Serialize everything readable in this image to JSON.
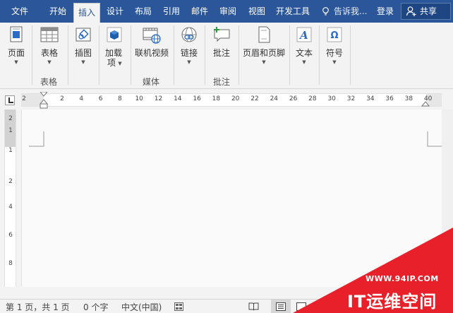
{
  "tabs": [
    {
      "label": "文件",
      "active": false
    },
    {
      "label": "开始",
      "active": false
    },
    {
      "label": "插入",
      "active": true
    },
    {
      "label": "设计",
      "active": false
    },
    {
      "label": "布局",
      "active": false
    },
    {
      "label": "引用",
      "active": false
    },
    {
      "label": "邮件",
      "active": false
    },
    {
      "label": "审阅",
      "active": false
    },
    {
      "label": "视图",
      "active": false
    },
    {
      "label": "开发工具",
      "active": false
    }
  ],
  "tell_me": "告诉我...",
  "login": "登录",
  "share": "共享",
  "ribbon": {
    "buttons": [
      {
        "label": "页面",
        "icon": "page-icon"
      },
      {
        "label": "表格",
        "icon": "table-icon"
      },
      {
        "label": "插图",
        "icon": "illustration-icon"
      },
      {
        "label": "加载项",
        "label_line1": "加载",
        "label_line2": "项",
        "icon": "addin-icon"
      },
      {
        "label": "联机视频",
        "icon": "online-video-icon"
      },
      {
        "label": "链接",
        "icon": "link-icon"
      },
      {
        "label": "批注",
        "icon": "comment-icon"
      },
      {
        "label": "页眉和页脚",
        "icon": "header-footer-icon"
      },
      {
        "label": "文本",
        "icon": "text-icon"
      },
      {
        "label": "符号",
        "icon": "symbol-icon"
      }
    ],
    "groups": {
      "table": "表格",
      "media": "媒体",
      "comments": "批注"
    }
  },
  "ruler": {
    "left_label": "2",
    "ticks": [
      "2",
      "4",
      "6",
      "8",
      "10",
      "12",
      "14",
      "16",
      "18",
      "20",
      "22",
      "24",
      "26",
      "28",
      "30",
      "32",
      "34",
      "36",
      "38",
      "40"
    ],
    "vertical_ticks": [
      "2",
      "1",
      "1",
      "2",
      "4",
      "6",
      "8"
    ]
  },
  "status": {
    "page": "第 1 页，共 1 页",
    "words": "0 个字",
    "language": "中文(中国)"
  },
  "watermark": {
    "url": "WWW.94IP.COM",
    "brand": "IT运维空间"
  },
  "colors": {
    "accent": "#2b579a",
    "watermark_red": "#e8202a"
  }
}
